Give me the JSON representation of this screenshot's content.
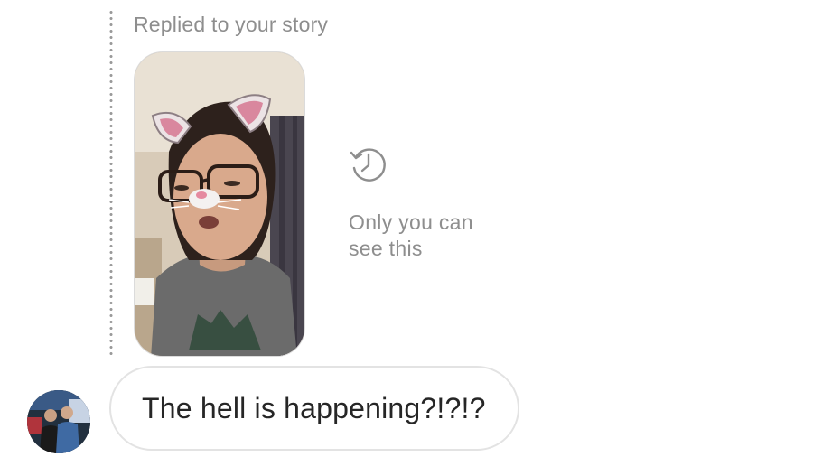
{
  "reply_header": {
    "label": "Replied to your story"
  },
  "story": {
    "thumbnail_icon": "story-photo"
  },
  "visibility_notice": {
    "icon": "history-icon",
    "text": "Only you can see this"
  },
  "message": {
    "text": "The hell is happening?!?!?",
    "sender_avatar_icon": "avatar"
  },
  "colors": {
    "secondary_text": "#8e8e8e",
    "primary_text": "#262626",
    "bubble_border": "#e3e3e3"
  }
}
